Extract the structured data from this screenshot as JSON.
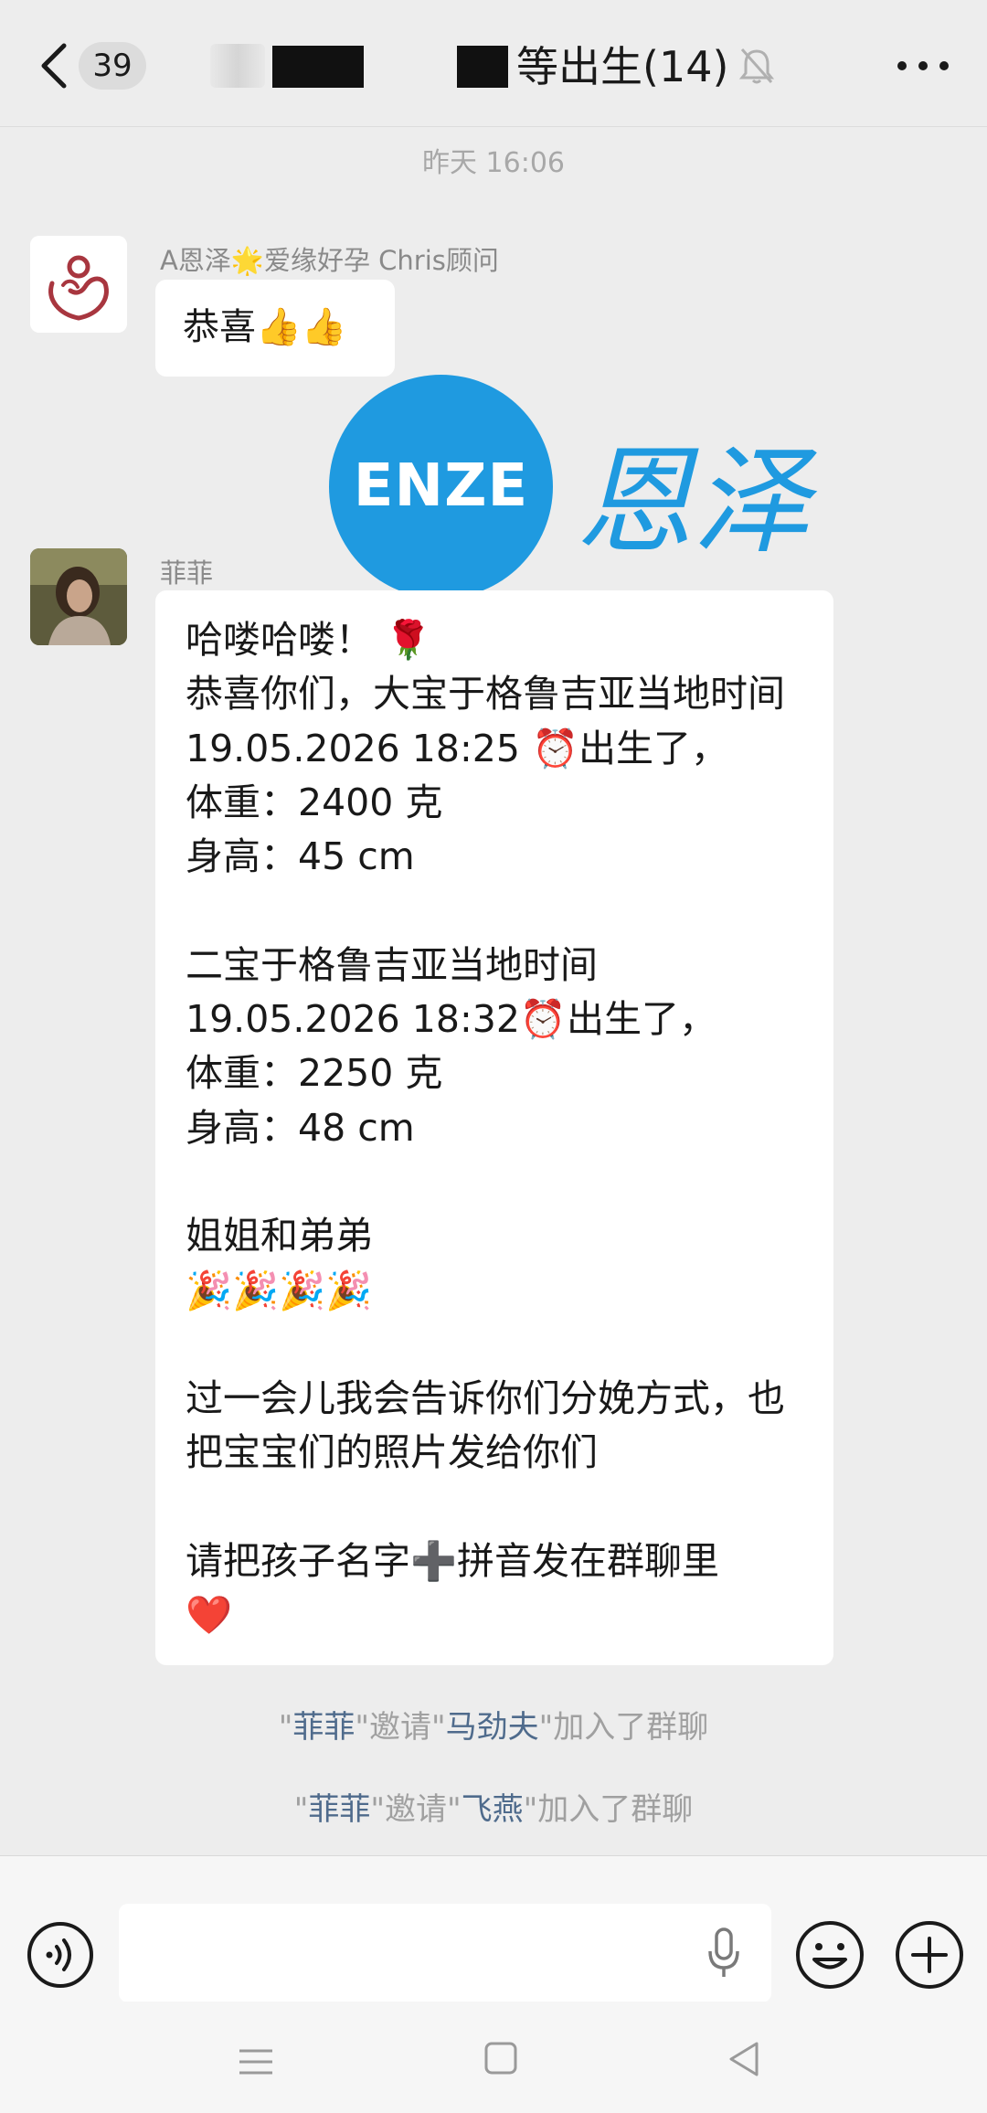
{
  "header": {
    "unread_count": "39",
    "title": "等出生(14)"
  },
  "timestamp": "昨天 16:06",
  "messages": [
    {
      "sender": "A恩泽🌟爱缘好孕 Chris顾问",
      "text": "恭喜👍👍"
    },
    {
      "sender": "菲菲",
      "text": "哈喽哈喽！ 🌹\n恭喜你们，大宝于格鲁吉亚当地时间 19.05.2026 18:25 ⏰出生了，\n体重：2400 克\n身高：45 cm\n\n二宝于格鲁吉亚当地时间\n19.05.2026 18:32⏰出生了，\n体重：2250 克\n身高：48 cm\n\n姐姐和弟弟\n🎉🎉🎉🎉\n\n过一会儿我会告诉你们分娩方式，也把宝宝们的照片发给你们\n\n请把孩子名字➕拼音发在群聊里\n❤️"
    }
  ],
  "system_messages": [
    {
      "q1": "\"",
      "inviter": "菲菲",
      "mid": "\"邀请\"",
      "invitee": "马劲夫",
      "tail": "\"加入了群聊"
    },
    {
      "q1": "\"",
      "inviter": "菲菲",
      "mid": "\"邀请\"",
      "invitee": "飞燕",
      "tail": "\"加入了群聊"
    }
  ],
  "watermark": {
    "latin": "ENZE",
    "cn": "恩泽"
  },
  "input": {
    "value": "",
    "placeholder": ""
  },
  "colors": {
    "accent_blue": "#1f9ae0",
    "name_link": "#4f6b8c",
    "bg": "#ededed"
  }
}
